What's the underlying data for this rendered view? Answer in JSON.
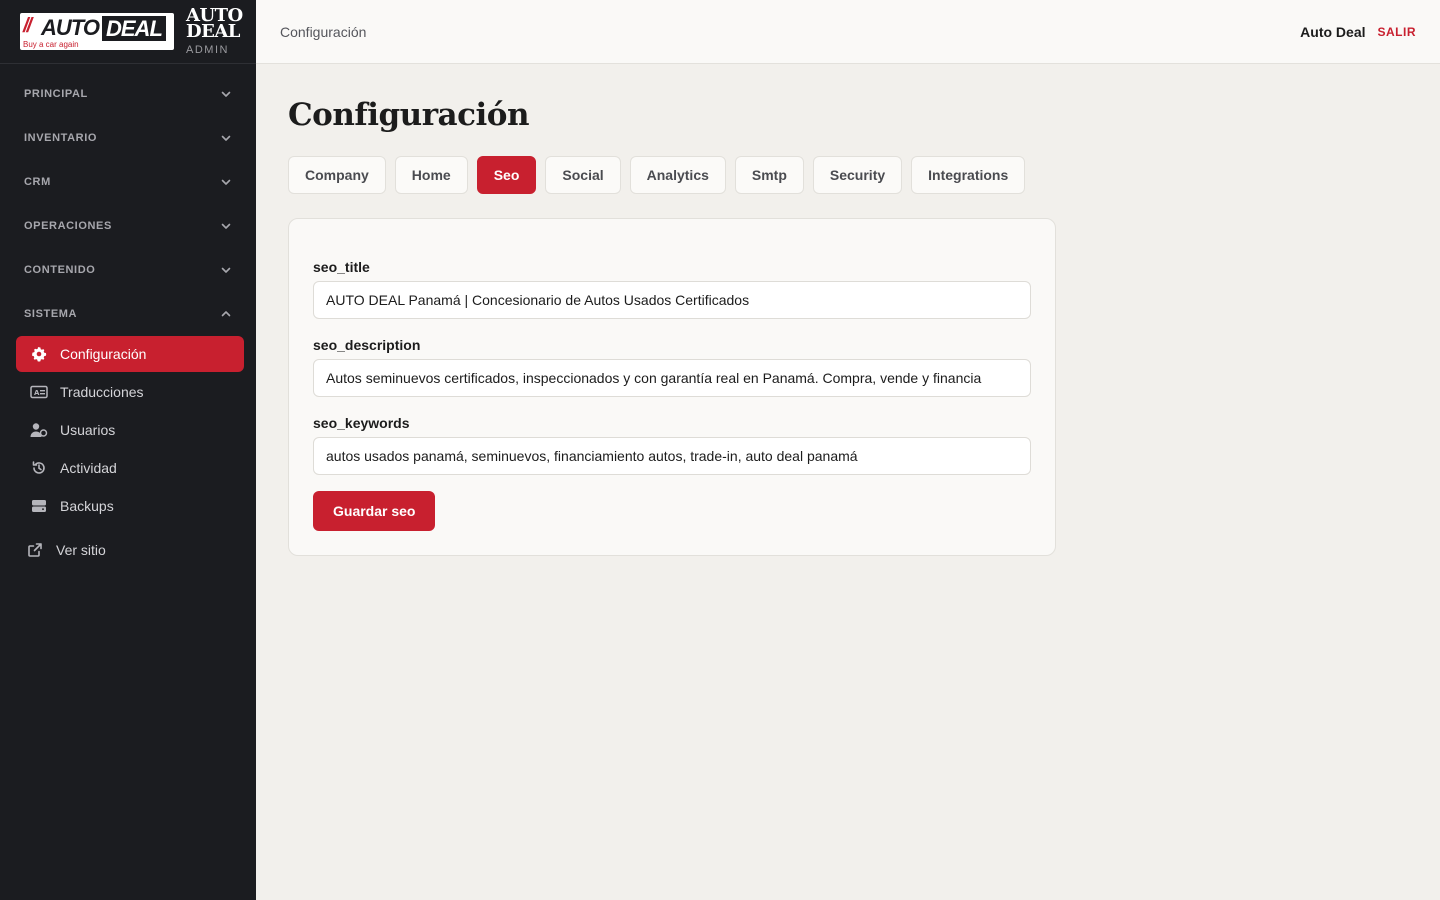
{
  "brand": {
    "logo_slashes": "//",
    "logo_auto": "AUTO",
    "logo_deal": "DEAL",
    "logo_tagline": "Buy a car again",
    "name_line1": "AUTO",
    "name_line2": "DEAL",
    "subtitle": "ADMIN"
  },
  "sidebar": {
    "sections": [
      {
        "label": "PRINCIPAL",
        "expanded": false
      },
      {
        "label": "INVENTARIO",
        "expanded": false
      },
      {
        "label": "CRM",
        "expanded": false
      },
      {
        "label": "OPERACIONES",
        "expanded": false
      },
      {
        "label": "CONTENIDO",
        "expanded": false
      },
      {
        "label": "SISTEMA",
        "expanded": true
      }
    ],
    "items": [
      {
        "label": "Configuración",
        "icon": "gear-icon",
        "active": true
      },
      {
        "label": "Traducciones",
        "icon": "translate-icon",
        "active": false
      },
      {
        "label": "Usuarios",
        "icon": "users-icon",
        "active": false
      },
      {
        "label": "Actividad",
        "icon": "history-icon",
        "active": false
      },
      {
        "label": "Backups",
        "icon": "database-icon",
        "active": false
      }
    ],
    "external_link": {
      "label": "Ver sitio",
      "icon": "external-link-icon"
    }
  },
  "topbar": {
    "title": "Configuración",
    "user": "Auto Deal",
    "logout": "SALIR"
  },
  "page": {
    "title": "Configuración"
  },
  "tabs": [
    {
      "label": "Company",
      "active": false
    },
    {
      "label": "Home",
      "active": false
    },
    {
      "label": "Seo",
      "active": true
    },
    {
      "label": "Social",
      "active": false
    },
    {
      "label": "Analytics",
      "active": false
    },
    {
      "label": "Smtp",
      "active": false
    },
    {
      "label": "Security",
      "active": false
    },
    {
      "label": "Integrations",
      "active": false
    }
  ],
  "form": {
    "fields": [
      {
        "label": "seo_title",
        "value": "AUTO DEAL Panamá | Concesionario de Autos Usados Certificados"
      },
      {
        "label": "seo_description",
        "value": "Autos seminuevos certificados, inspeccionados y con garantía real en Panamá. Compra, vende y financia"
      },
      {
        "label": "seo_keywords",
        "value": "autos usados panamá, seminuevos, financiamiento autos, trade-in, auto deal panamá"
      }
    ],
    "save_label": "Guardar seo"
  },
  "colors": {
    "accent": "#c8202f",
    "sidebar_bg": "#1b1c20",
    "page_bg": "#f2f0ec"
  }
}
